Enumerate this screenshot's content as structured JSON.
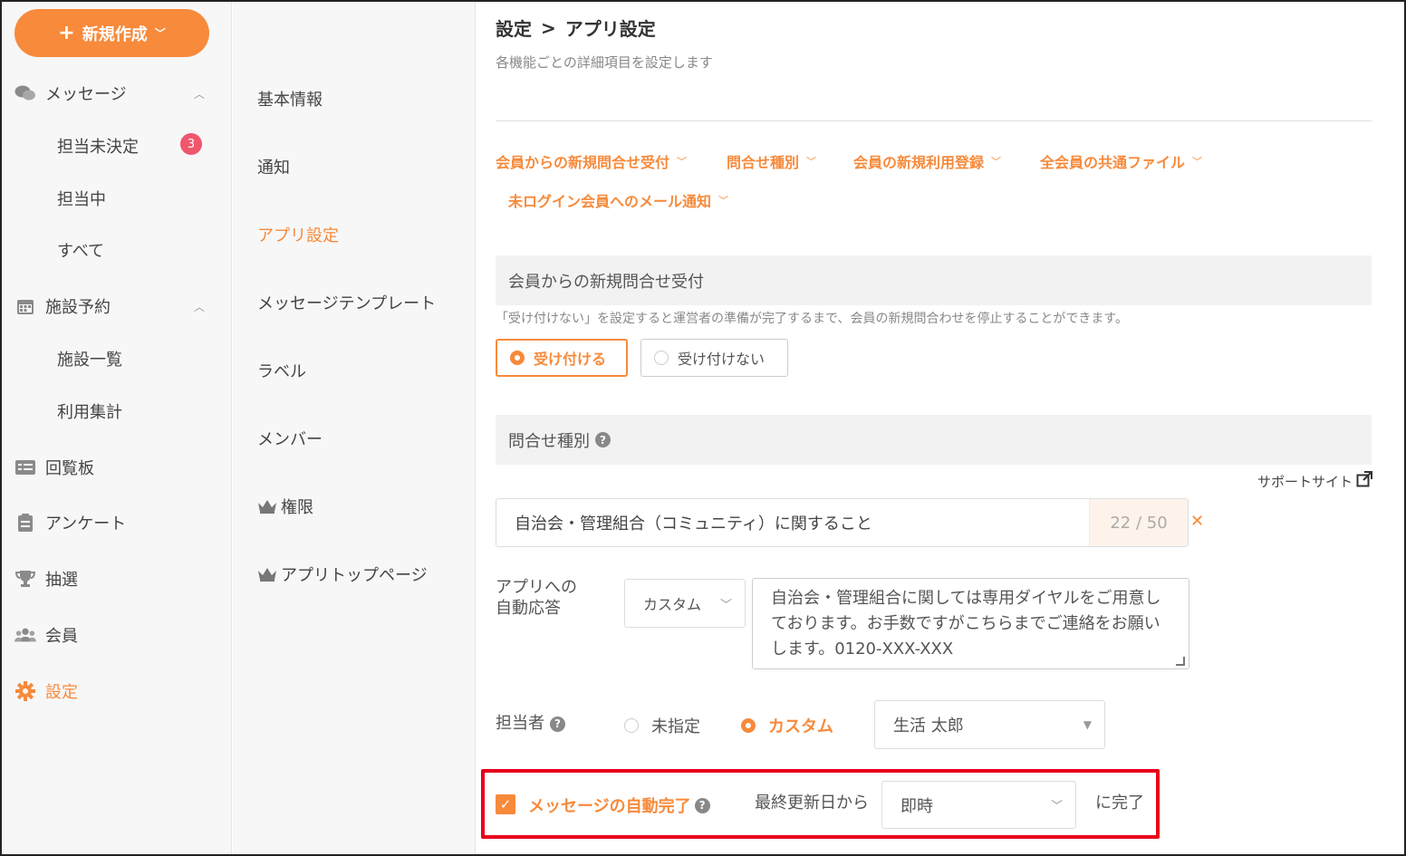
{
  "sidebar": {
    "new_button": "新規作成",
    "items": [
      {
        "label": "メッセージ",
        "icon": "chat-icon"
      },
      {
        "label": "担当未決定",
        "badge": "3"
      },
      {
        "label": "担当中"
      },
      {
        "label": "すべて"
      },
      {
        "label": "施設予約",
        "icon": "calendar-icon"
      },
      {
        "label": "施設一覧"
      },
      {
        "label": "利用集計"
      },
      {
        "label": "回覧板",
        "icon": "board-icon"
      },
      {
        "label": "アンケート",
        "icon": "clipboard-icon"
      },
      {
        "label": "抽選",
        "icon": "trophy-icon"
      },
      {
        "label": "会員",
        "icon": "users-icon"
      },
      {
        "label": "設定",
        "icon": "gear-icon"
      }
    ]
  },
  "settings_nav": {
    "items": [
      "基本情報",
      "通知",
      "アプリ設定",
      "メッセージテンプレート",
      "ラベル",
      "メンバー",
      "権限",
      "アプリトップページ"
    ],
    "active": "アプリ設定"
  },
  "header": {
    "crumb_root": "設定",
    "crumb_sep": ">",
    "crumb_current": "アプリ設定",
    "subtitle": "各機能ごとの詳細項目を設定します"
  },
  "anchors": [
    "会員からの新規問合せ受付",
    "問合せ種別",
    "会員の新規利用登録",
    "全会員の共通ファイル",
    "未ログイン会員へのメール通知"
  ],
  "section_inquiry": {
    "title": "会員からの新規問合せ受付",
    "note": "「受け付けない」を設定すると運営者の準備が完了するまで、会員の新規問合わせを停止することができます。",
    "accept": "受け付ける",
    "reject": "受け付けない"
  },
  "section_type": {
    "title": "問合せ種別",
    "support_link": "サポートサイト",
    "type_value": "自治会・管理組合（コミュニティ）に関すること",
    "char_count": "22 / 50",
    "auto_reply_label_1": "アプリへの",
    "auto_reply_label_2": "自動応答",
    "auto_reply_select": "カスタム",
    "auto_reply_text": "自治会・管理組合に関しては専用ダイヤルをご用意しております。お手数ですがこちらまでご連絡をお願いします。0120-XXX-XXX",
    "assignee_label": "担当者",
    "assignee_none": "未指定",
    "assignee_custom": "カスタム",
    "assignee_value": "生活 太郎",
    "auto_complete_label": "メッセージの自動完了",
    "auto_complete_from": "最終更新日から",
    "auto_complete_select": "即時",
    "auto_complete_suffix": "に完了"
  },
  "colors": {
    "accent": "#f78a3b",
    "badge": "#f0566c",
    "highlight": "#e8001c"
  }
}
